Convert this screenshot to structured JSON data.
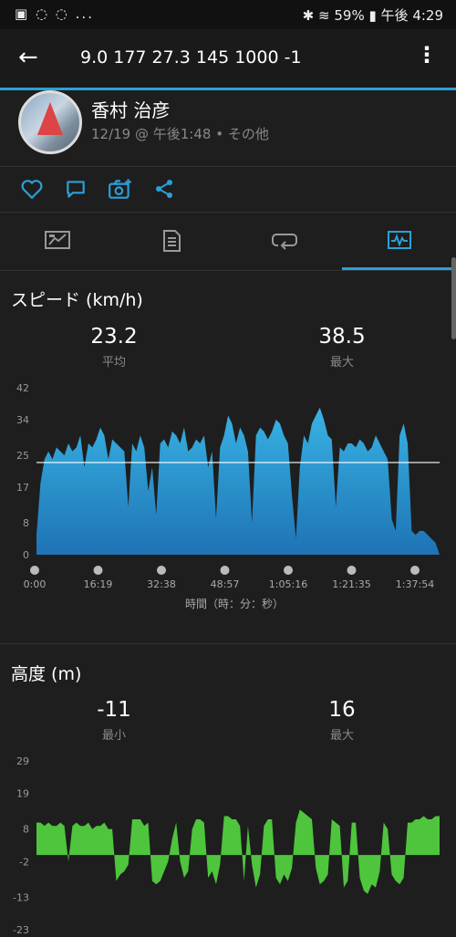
{
  "status_bar": {
    "left_icons": "▣ ◌ ◌ ...",
    "battery": "59%",
    "time": "午後 4:29"
  },
  "app_bar": {
    "title": "9.0  177  27.3  145  1000  -1"
  },
  "profile": {
    "name": "香村 治彦",
    "meta": "12/19 @ 午後1:48 • その他"
  },
  "actions": [
    {
      "icon": "heart-icon"
    },
    {
      "icon": "comment-icon"
    },
    {
      "icon": "camera-add-icon"
    },
    {
      "icon": "share-icon"
    }
  ],
  "tabs": [
    {
      "icon": "summary-icon",
      "active": false
    },
    {
      "icon": "details-icon",
      "active": false
    },
    {
      "icon": "laps-icon",
      "active": false
    },
    {
      "icon": "charts-icon",
      "active": true
    }
  ],
  "speed": {
    "title": "スピード (km/h)",
    "avg_value": "23.2",
    "avg_label": "平均",
    "max_value": "38.5",
    "max_label": "最大"
  },
  "altitude": {
    "title": "高度 (m)",
    "min_value": "-11",
    "min_label": "最小",
    "max_value": "16",
    "max_label": "最大"
  },
  "chart_data": [
    {
      "type": "area",
      "title": "スピード (km/h)",
      "xlabel": "時間（時：分：秒）",
      "x_ticks": [
        "0:00",
        "16:19",
        "32:38",
        "48:57",
        "1:05:16",
        "1:21:35",
        "1:37:54"
      ],
      "y_ticks": [
        "0",
        "8",
        "17",
        "25",
        "34",
        "42"
      ],
      "ylim": [
        0,
        42
      ],
      "xlim_minutes": [
        0,
        101
      ],
      "avg_line": 23.2,
      "color": "#2a9ad0",
      "x": [
        0,
        1,
        2,
        3,
        4,
        5,
        6,
        7,
        8,
        9,
        10,
        11,
        12,
        13,
        14,
        15,
        16,
        17,
        18,
        19,
        20,
        21,
        22,
        23,
        24,
        25,
        26,
        27,
        28,
        29,
        30,
        31,
        32,
        33,
        34,
        35,
        36,
        37,
        38,
        39,
        40,
        41,
        42,
        43,
        44,
        45,
        46,
        47,
        48,
        49,
        50,
        51,
        52,
        53,
        54,
        55,
        56,
        57,
        58,
        59,
        60,
        61,
        62,
        63,
        64,
        65,
        66,
        67,
        68,
        69,
        70,
        71,
        72,
        73,
        74,
        75,
        76,
        77,
        78,
        79,
        80,
        81,
        82,
        83,
        84,
        85,
        86,
        87,
        88,
        89,
        90,
        91,
        92,
        93,
        94,
        95,
        96,
        97,
        98,
        99,
        100,
        101
      ],
      "values": [
        5,
        18,
        24,
        26,
        24,
        27,
        26,
        25,
        28,
        26,
        27,
        30,
        22,
        28,
        27,
        29,
        32,
        30,
        24,
        29,
        28,
        27,
        26,
        12,
        28,
        26,
        30,
        27,
        16,
        22,
        10,
        28,
        29,
        27,
        31,
        30,
        28,
        32,
        26,
        27,
        29,
        28,
        30,
        22,
        26,
        9,
        27,
        30,
        35,
        33,
        28,
        32,
        30,
        26,
        8,
        30,
        32,
        31,
        29,
        31,
        34,
        33,
        30,
        28,
        15,
        4,
        22,
        30,
        28,
        33,
        35,
        37,
        34,
        30,
        29,
        12,
        27,
        26,
        28,
        28,
        27,
        29,
        28,
        26,
        27,
        30,
        28,
        26,
        24,
        9,
        6,
        30,
        33,
        28,
        6,
        5,
        6,
        6,
        5,
        4,
        3,
        0
      ]
    },
    {
      "type": "area",
      "title": "高度 (m)",
      "y_ticks": [
        "29",
        "19",
        "8",
        "-2",
        "-13",
        "-23"
      ],
      "ylim": [
        -23,
        29
      ],
      "color": "#4ec53c",
      "x": [
        0,
        1,
        2,
        3,
        4,
        5,
        6,
        7,
        8,
        9,
        10,
        11,
        12,
        13,
        14,
        15,
        16,
        17,
        18,
        19,
        20,
        21,
        22,
        23,
        24,
        25,
        26,
        27,
        28,
        29,
        30,
        31,
        32,
        33,
        34,
        35,
        36,
        37,
        38,
        39,
        40,
        41,
        42,
        43,
        44,
        45,
        46,
        47,
        48,
        49,
        50,
        51,
        52,
        53,
        54,
        55,
        56,
        57,
        58,
        59,
        60,
        61,
        62,
        63,
        64,
        65,
        66,
        67,
        68,
        69,
        70,
        71,
        72,
        73,
        74,
        75,
        76,
        77,
        78,
        79,
        80,
        81,
        82,
        83,
        84,
        85,
        86,
        87,
        88,
        89,
        90,
        91,
        92,
        93,
        94,
        95,
        96,
        97,
        98,
        99,
        100,
        101
      ],
      "values": [
        10,
        10,
        9,
        10,
        9,
        9,
        10,
        9,
        -2,
        9,
        10,
        9,
        9,
        10,
        8,
        9,
        9,
        10,
        8,
        8,
        -8,
        -6,
        -5,
        -3,
        11,
        11,
        11,
        9,
        10,
        -8,
        -9,
        -8,
        -5,
        -2,
        5,
        10,
        -2,
        -7,
        -5,
        8,
        11,
        11,
        10,
        -7,
        -5,
        -9,
        -3,
        12,
        12,
        11,
        11,
        9,
        -8,
        9,
        -3,
        -10,
        -6,
        9,
        11,
        11,
        -7,
        -9,
        -6,
        -8,
        -4,
        10,
        14,
        13,
        12,
        11,
        -4,
        -9,
        -8,
        -6,
        11,
        10,
        9,
        -10,
        -8,
        10,
        10,
        -7,
        -11,
        -12,
        -9,
        -10,
        -5,
        10,
        8,
        -6,
        -8,
        -9,
        -7,
        10,
        10,
        11,
        11,
        12,
        11,
        11,
        12,
        12
      ]
    }
  ]
}
